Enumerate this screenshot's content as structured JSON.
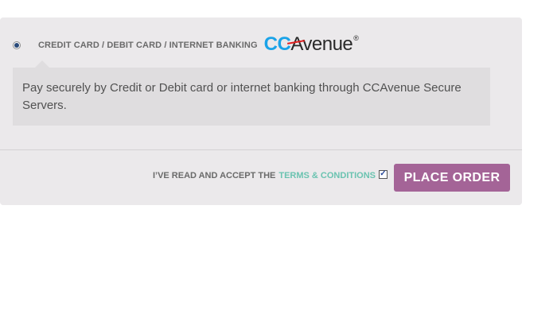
{
  "payment_method": {
    "label": "CREDIT CARD / DEBIT CARD / INTERNET BANKING",
    "selected": true,
    "logo": {
      "part1": "CC",
      "part2": "Avenue",
      "registered": "®",
      "brand_color": "#1aa3e8"
    },
    "description": "Pay securely by Credit or Debit card or internet banking through CCAvenue Secure Servers."
  },
  "terms": {
    "prefix": "I’VE READ AND ACCEPT THE",
    "link_text": "TERMS & CONDITIONS",
    "checked": true,
    "check_glyph": "✓"
  },
  "place_order": {
    "label": "PLACE ORDER",
    "color": "#a46497"
  }
}
